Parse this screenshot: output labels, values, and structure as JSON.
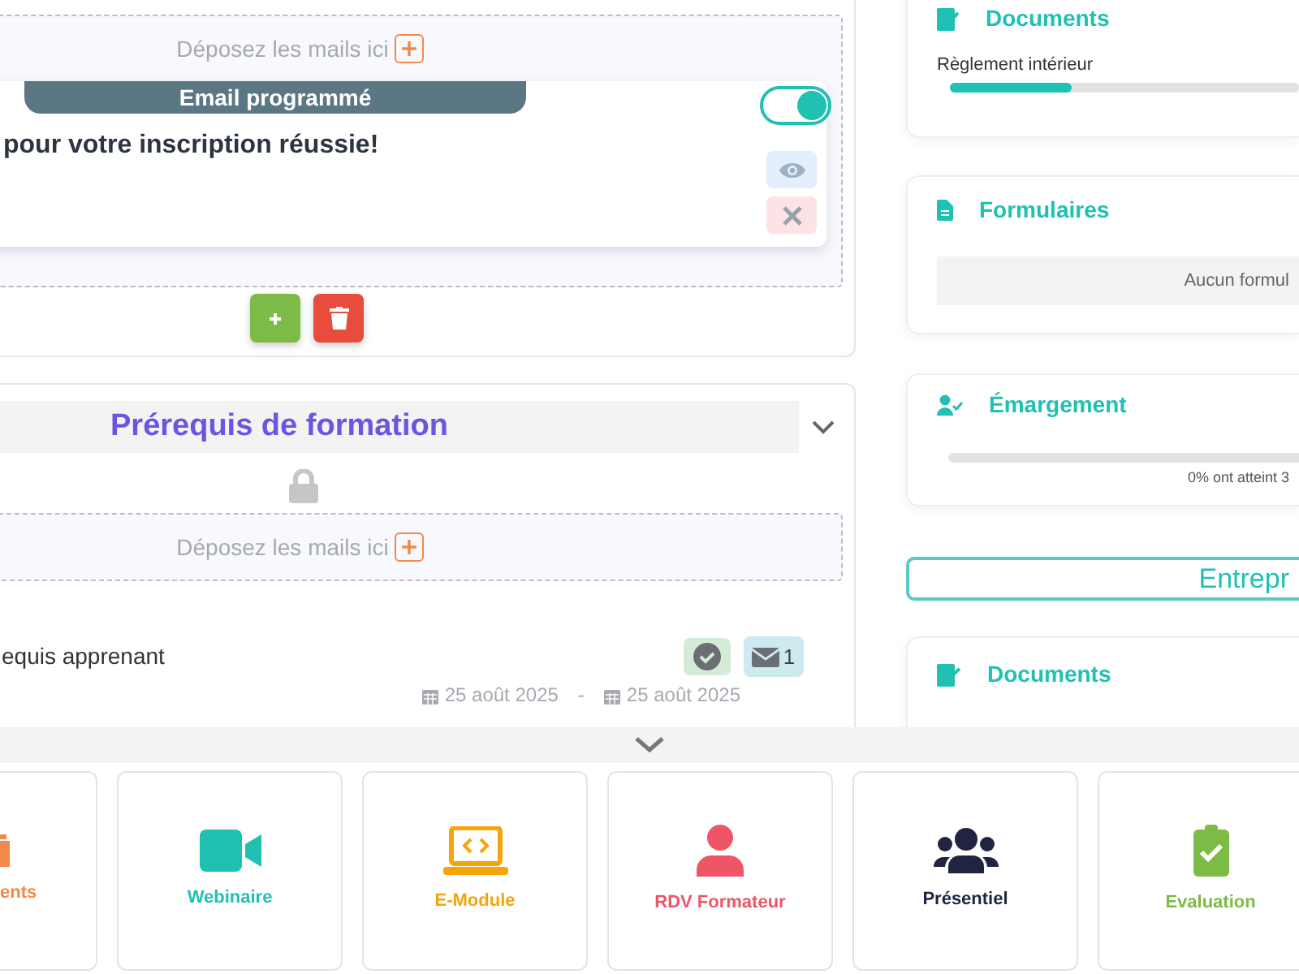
{
  "mail_zone": {
    "drop_label": "Déposez les mails ici",
    "email": {
      "banner": "Email programmé",
      "title": "pour votre inscription réussie!",
      "on": true
    }
  },
  "section": {
    "title": "Prérequis de formation",
    "drop_label": "Déposez les mails ici",
    "item": {
      "title": "equis apprenant",
      "mail_count": "1",
      "start_date": "25 août 2025",
      "separator": "-",
      "end_date": "25 août 2025"
    }
  },
  "sidebar": {
    "documents": {
      "title": "Documents",
      "items": [
        {
          "label": "Règlement intérieur",
          "level": 0.35
        }
      ]
    },
    "forms": {
      "title": "Formulaires",
      "empty_text": "Aucun formul"
    },
    "attendance": {
      "title": "Émargement",
      "level": 0,
      "caption": "0% ont atteint 3"
    },
    "company_heading": "Entrepr",
    "company_documents": {
      "title": "Documents"
    }
  },
  "tiles": [
    {
      "label": "ents",
      "kind": "partial",
      "color": "#f08a4b"
    },
    {
      "label": "Webinaire",
      "kind": "video",
      "color": "#20c0b3"
    },
    {
      "label": "E-Module",
      "kind": "laptop",
      "color": "#f5a50a"
    },
    {
      "label": "RDV Formateur",
      "kind": "person",
      "color": "#ee5566"
    },
    {
      "label": "Présentiel",
      "kind": "group",
      "color": "#1f2540"
    },
    {
      "label": "Evaluation",
      "kind": "clipboard",
      "color": "#7cbb45"
    }
  ]
}
